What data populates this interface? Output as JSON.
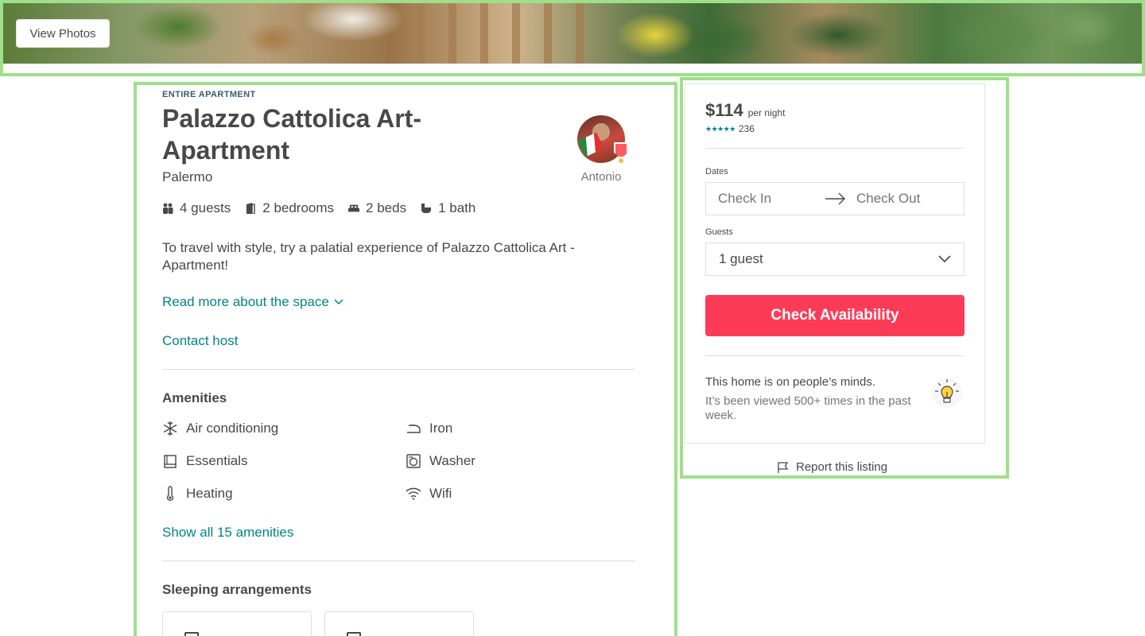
{
  "hero": {
    "view_photos_label": "View Photos"
  },
  "listing": {
    "type": "ENTIRE APARTMENT",
    "title": "Palazzo Cattolica Art-Apartment",
    "city": "Palermo",
    "host_name": "Antonio",
    "facts": {
      "guests": "4 guests",
      "bedrooms": "2 bedrooms",
      "beds": "2 beds",
      "baths": "1 bath"
    },
    "description": "To travel with style, try a palatial experience of Palazzo Cattolica Art - Apartment!",
    "read_more": "Read more about the space",
    "contact_host": "Contact host"
  },
  "amenities": {
    "title": "Amenities",
    "items": [
      {
        "label": "Air conditioning",
        "icon": "snowflake-icon"
      },
      {
        "label": "Iron",
        "icon": "iron-icon"
      },
      {
        "label": "Essentials",
        "icon": "essentials-icon"
      },
      {
        "label": "Washer",
        "icon": "washer-icon"
      },
      {
        "label": "Heating",
        "icon": "thermometer-icon"
      },
      {
        "label": "Wifi",
        "icon": "wifi-icon"
      }
    ],
    "show_all": "Show all 15 amenities"
  },
  "sleeping": {
    "title": "Sleeping arrangements"
  },
  "booking": {
    "price": "$114",
    "per_night": "per night",
    "stars": "★★★★★",
    "review_count": "236",
    "dates_label": "Dates",
    "check_in_placeholder": "Check In",
    "check_out_placeholder": "Check Out",
    "guests_label": "Guests",
    "guests_value": "1 guest",
    "cta_label": "Check Availability",
    "accent_color": "#fc3c57",
    "link_color": "#008489",
    "minds_title": "This home is on people’s minds.",
    "minds_text": "It’s been viewed 500+ times in the past week.",
    "report_label": "Report this listing"
  }
}
